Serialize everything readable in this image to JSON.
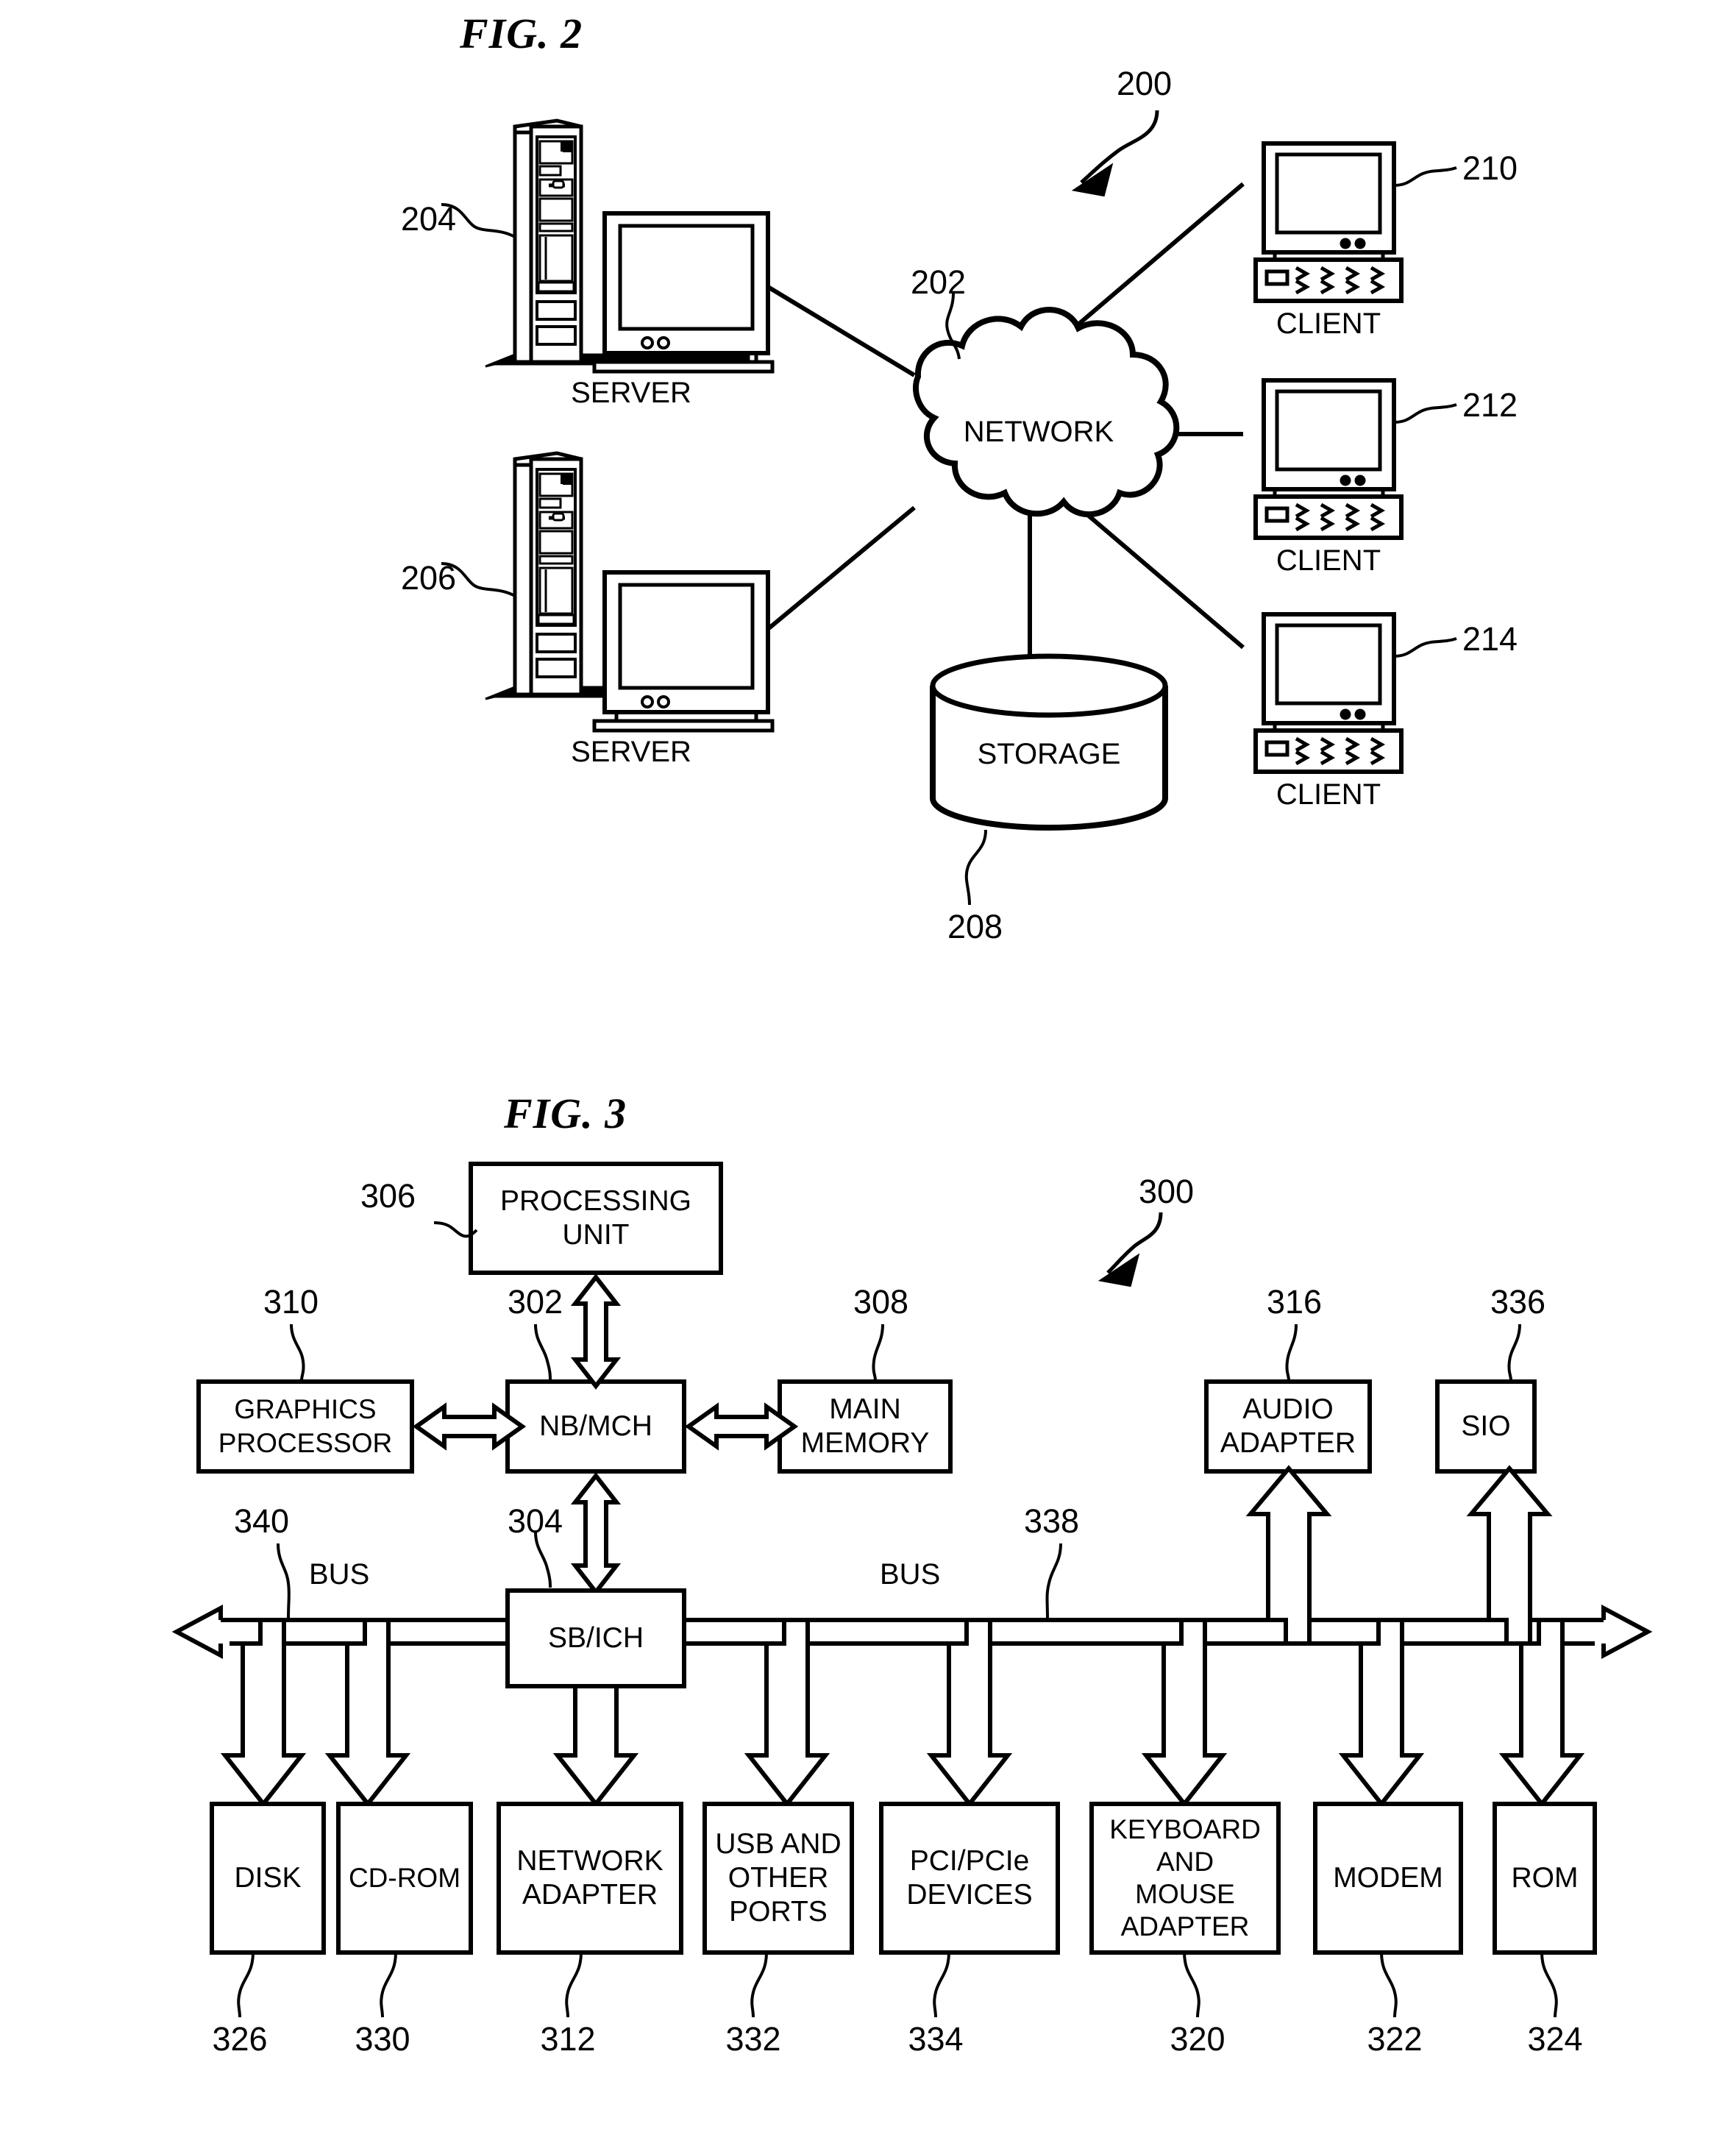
{
  "figures": [
    {
      "id": "fig2",
      "title": "FIG. 2",
      "system_ref": "200",
      "nodes": {
        "network": {
          "label": "NETWORK",
          "ref": "202"
        },
        "storage": {
          "label": "STORAGE",
          "ref": "208"
        },
        "server_top": {
          "caption": "SERVER",
          "ref": "204"
        },
        "server_bottom": {
          "caption": "SERVER",
          "ref": "206"
        },
        "client_1": {
          "caption": "CLIENT",
          "ref": "210"
        },
        "client_2": {
          "caption": "CLIENT",
          "ref": "212"
        },
        "client_3": {
          "caption": "CLIENT",
          "ref": "214"
        }
      }
    },
    {
      "id": "fig3",
      "title": "FIG. 3",
      "system_ref": "300",
      "bus_left": {
        "label": "BUS",
        "ref": "340"
      },
      "bus_right": {
        "label": "BUS",
        "ref": "338"
      },
      "blocks": [
        {
          "key": "processing_unit",
          "label": "PROCESSING\nUNIT",
          "ref": "306"
        },
        {
          "key": "graphics_processor",
          "label": "GRAPHICS\nPROCESSOR",
          "ref": "310"
        },
        {
          "key": "nb_mch",
          "label": "NB/MCH",
          "ref": "302"
        },
        {
          "key": "main_memory",
          "label": "MAIN\nMEMORY",
          "ref": "308"
        },
        {
          "key": "audio_adapter",
          "label": "AUDIO\nADAPTER",
          "ref": "316"
        },
        {
          "key": "sio",
          "label": "SIO",
          "ref": "336"
        },
        {
          "key": "sb_ich",
          "label": "SB/ICH",
          "ref": "304"
        },
        {
          "key": "disk",
          "label": "DISK",
          "ref": "326"
        },
        {
          "key": "cd_rom",
          "label": "CD-ROM",
          "ref": "330"
        },
        {
          "key": "network_adapter",
          "label": "NETWORK\nADAPTER",
          "ref": "312"
        },
        {
          "key": "usb_ports",
          "label": "USB AND\nOTHER\nPORTS",
          "ref": "332"
        },
        {
          "key": "pci_devices",
          "label": "PCI/PCIe\nDEVICES",
          "ref": "334"
        },
        {
          "key": "keyboard_mouse_adapter",
          "label": "KEYBOARD\nAND\nMOUSE\nADAPTER",
          "ref": "320"
        },
        {
          "key": "modem",
          "label": "MODEM",
          "ref": "322"
        },
        {
          "key": "rom",
          "label": "ROM",
          "ref": "324"
        }
      ]
    }
  ],
  "style": {
    "ink": "#000000",
    "paper": "#ffffff"
  }
}
